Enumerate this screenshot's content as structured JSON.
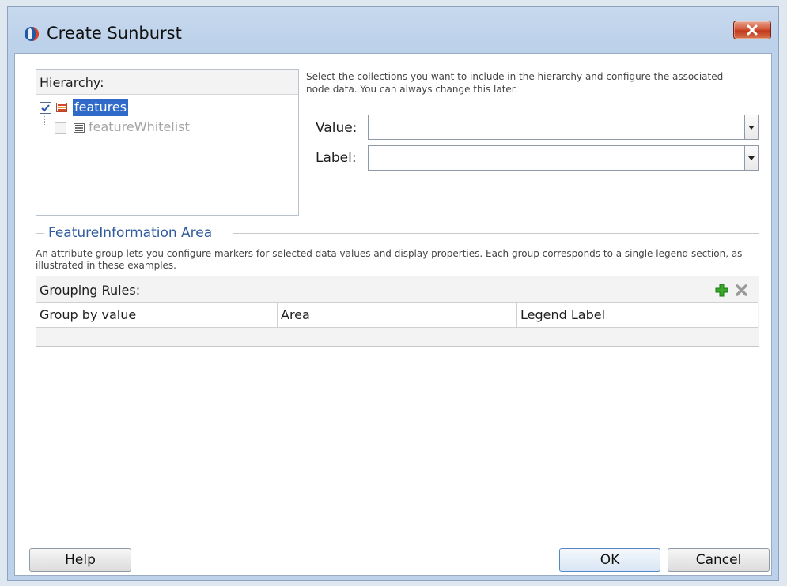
{
  "window": {
    "title": "Create Sunburst"
  },
  "hierarchy": {
    "header": "Hierarchy:",
    "items": [
      {
        "label": "features",
        "checked": true,
        "selected": true
      },
      {
        "label": "featureWhitelist",
        "checked": false,
        "disabled": true
      }
    ]
  },
  "instructions": "Select the collections you want to include in the hierarchy and configure the associated node data. You can always change this later.",
  "fields": {
    "value": {
      "label": "Value:",
      "value": ""
    },
    "label": {
      "label": "Label:",
      "value": ""
    }
  },
  "section": {
    "title": "FeatureInformation Area",
    "description": "An attribute group lets you configure markers for selected data values and display properties. Each group corresponds to a single legend section, as illustrated in these examples."
  },
  "grouping": {
    "header": "Grouping Rules:",
    "columns": [
      "Group by value",
      "Area",
      "Legend Label"
    ],
    "rows": []
  },
  "buttons": {
    "help": "Help",
    "ok": "OK",
    "cancel": "Cancel"
  },
  "icons": {
    "app": "oracle-icon",
    "close": "close-icon",
    "add": "add-icon",
    "delete": "delete-icon",
    "node": "collection-icon"
  },
  "colors": {
    "selection": "#2f6ac9",
    "section_title": "#2f5a9c",
    "close_button": "#c0391b",
    "add_icon": "#3aa829"
  }
}
